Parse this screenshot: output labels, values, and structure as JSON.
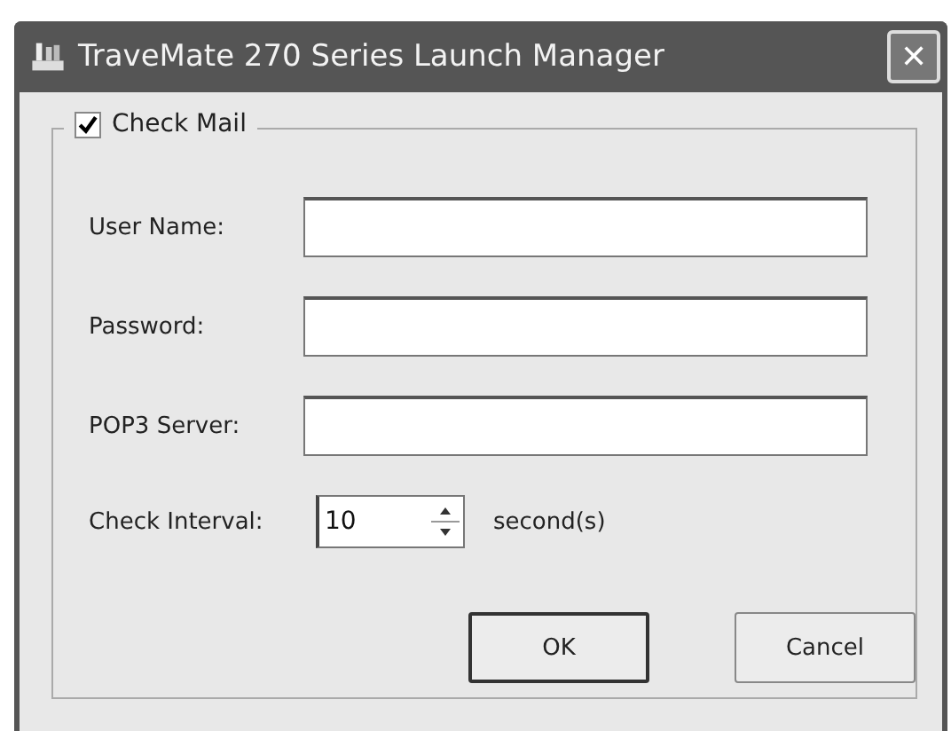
{
  "window": {
    "title": "TraveMate 270 Series Launch Manager",
    "close": "✕"
  },
  "group": {
    "label": "Check Mail",
    "checked": true
  },
  "fields": [
    {
      "label": "User Name:"
    },
    {
      "label": "Password:"
    },
    {
      "label": "POP3 Server:"
    }
  ],
  "interval": {
    "label": "Check Interval:",
    "value": "10",
    "unit": "second(s)"
  },
  "buttons": [
    {
      "label": "OK",
      "default": true
    },
    {
      "label": "Cancel",
      "default": false
    }
  ]
}
